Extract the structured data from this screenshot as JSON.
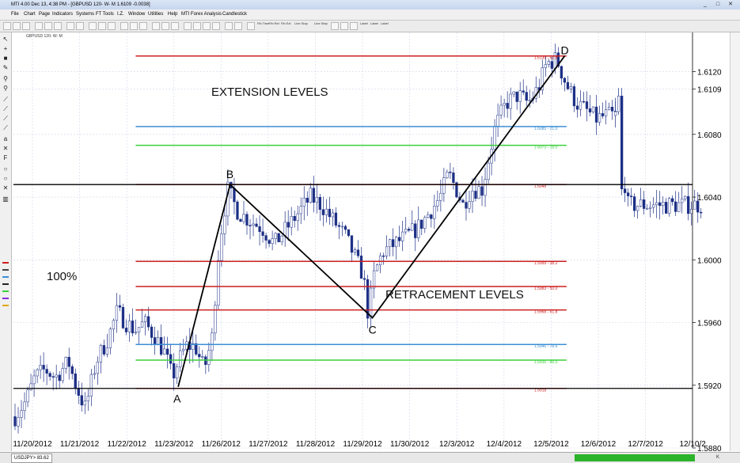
{
  "window": {
    "title": "MTI 4.00 Dec 13, 4:38 PM - [GBPUSD 120- W- M  1.6109  -0.0038]",
    "buttons": [
      "_",
      "□",
      "✕"
    ]
  },
  "menu": [
    "File",
    "Chart",
    "Page",
    "Indicators",
    "Systems",
    "FT Tools",
    "I.Z.",
    "Window",
    "Utilities",
    "Help",
    "MTI Forex Analysis",
    "Candlestick"
  ],
  "toolbar": {
    "labels": [
      "Fib Time",
      "Fib Ret",
      "Fib Ext",
      "Line Stop",
      "Line Step",
      "Label",
      "Label",
      "Label"
    ]
  },
  "chart_header": "GBPUSD 120- W- M",
  "status": {
    "tab": "USDJPY> 83.62",
    "corner": "K"
  },
  "colors": {
    "red": "#cc1f1f",
    "blue": "#3d8fd6",
    "green": "#3cd03c",
    "candle": "#1c2f86",
    "grid": "#cfd6e8"
  },
  "chart_data": {
    "type": "candlestick",
    "ylim": [
      1.588,
      1.6145
    ],
    "y_ticks": [
      "1.6120",
      "1.6109",
      "1.6080",
      "1.6040",
      "1.6000",
      "1.5960",
      "1.5920",
      "1.5880"
    ],
    "x_ticks": [
      "11/20/2012",
      "11/21/2012",
      "11/22/2012",
      "11/23/2012",
      "11/26/2012",
      "11/27/2012",
      "11/28/2012",
      "11/29/2012",
      "11/30/2012",
      "12/3/2012",
      "12/4/2012",
      "12/5/2012",
      "12/6/2012",
      "12/7/2012",
      "12/10/2"
    ],
    "annotations": {
      "extension": "EXTENSION LEVELS",
      "retracement": "RETRACEMENT LEVELS",
      "pct": "100%"
    },
    "points": [
      {
        "label": "A",
        "x": 0.2695,
        "price": 1.5919
      },
      {
        "label": "B",
        "x": 0.3545,
        "price": 1.6048
      },
      {
        "label": "C",
        "x": 0.5874,
        "price": 1.5963
      },
      {
        "label": "D",
        "x": 0.9019,
        "price": 1.613
      }
    ],
    "fib_levels": [
      {
        "label": "1.6130 - 61.8",
        "price": 1.613,
        "color": "red"
      },
      {
        "label": "1.6085 - 21.0",
        "price": 1.6085,
        "color": "blue"
      },
      {
        "label": "1.6073 - 18.0",
        "price": 1.6073,
        "color": "green"
      },
      {
        "label": "1.6048",
        "price": 1.6048,
        "color": "red"
      },
      {
        "label": "1.5999 - 38.2",
        "price": 1.5999,
        "color": "red"
      },
      {
        "label": "1.5983 - 50.0",
        "price": 1.5983,
        "color": "red"
      },
      {
        "label": "1.5968 - 61.8",
        "price": 1.5968,
        "color": "red"
      },
      {
        "label": "1.5946 - 78.6",
        "price": 1.5946,
        "color": "blue"
      },
      {
        "label": "1.5936 - 86.0",
        "price": 1.5936,
        "color": "green"
      },
      {
        "label": "1.5918",
        "price": 1.5918,
        "color": "red"
      }
    ],
    "horizontal_lines": [
      {
        "price": 1.6048,
        "color": "black"
      },
      {
        "price": 1.5918,
        "color": "black"
      }
    ],
    "anchors": [
      [
        0.0,
        1.59
      ],
      [
        0.018,
        1.591
      ],
      [
        0.033,
        1.5925
      ],
      [
        0.05,
        1.593
      ],
      [
        0.067,
        1.5925
      ],
      [
        0.089,
        1.5935
      ],
      [
        0.101,
        1.592
      ],
      [
        0.117,
        1.5905
      ],
      [
        0.135,
        1.5935
      ],
      [
        0.155,
        1.595
      ],
      [
        0.17,
        1.5967
      ],
      [
        0.185,
        1.596
      ],
      [
        0.2,
        1.5955
      ],
      [
        0.215,
        1.596
      ],
      [
        0.235,
        1.595
      ],
      [
        0.25,
        1.594
      ],
      [
        0.262,
        1.5925
      ],
      [
        0.272,
        1.5935
      ],
      [
        0.285,
        1.5945
      ],
      [
        0.3,
        1.5945
      ],
      [
        0.315,
        1.593
      ],
      [
        0.328,
        1.595
      ],
      [
        0.34,
        1.601
      ],
      [
        0.354,
        1.6045
      ],
      [
        0.372,
        1.603
      ],
      [
        0.392,
        1.6025
      ],
      [
        0.412,
        1.602
      ],
      [
        0.432,
        1.601
      ],
      [
        0.452,
        1.602
      ],
      [
        0.472,
        1.603
      ],
      [
        0.492,
        1.604
      ],
      [
        0.51,
        1.6035
      ],
      [
        0.53,
        1.6025
      ],
      [
        0.55,
        1.6015
      ],
      [
        0.568,
        1.6
      ],
      [
        0.58,
        1.599
      ],
      [
        0.588,
        1.5965
      ],
      [
        0.598,
        1.599
      ],
      [
        0.612,
        1.6005
      ],
      [
        0.632,
        1.601
      ],
      [
        0.652,
        1.6015
      ],
      [
        0.67,
        1.602
      ],
      [
        0.69,
        1.603
      ],
      [
        0.708,
        1.604
      ],
      [
        0.722,
        1.6055
      ],
      [
        0.735,
        1.6045
      ],
      [
        0.746,
        1.6035
      ],
      [
        0.76,
        1.6045
      ],
      [
        0.778,
        1.6045
      ],
      [
        0.8,
        1.6085
      ],
      [
        0.818,
        1.61
      ],
      [
        0.838,
        1.6105
      ],
      [
        0.855,
        1.61
      ],
      [
        0.872,
        1.611
      ],
      [
        0.885,
        1.6125
      ],
      [
        0.902,
        1.6128
      ],
      [
        0.918,
        1.6112
      ],
      [
        0.935,
        1.61
      ],
      [
        0.952,
        1.6095
      ],
      [
        0.968,
        1.609
      ],
      [
        0.985,
        1.6092
      ]
    ],
    "tail_anchors": [
      [
        0.0,
        1.6092
      ],
      [
        0.018,
        1.6085
      ],
      [
        0.03,
        1.61
      ],
      [
        0.045,
        1.6105
      ],
      [
        0.055,
        1.609
      ],
      [
        0.063,
        1.606
      ],
      [
        0.07,
        1.6042
      ],
      [
        0.085,
        1.6048
      ],
      [
        0.1,
        1.6046
      ],
      [
        0.118,
        1.605
      ],
      [
        0.13,
        1.604
      ],
      [
        0.14,
        1.6035
      ]
    ]
  }
}
